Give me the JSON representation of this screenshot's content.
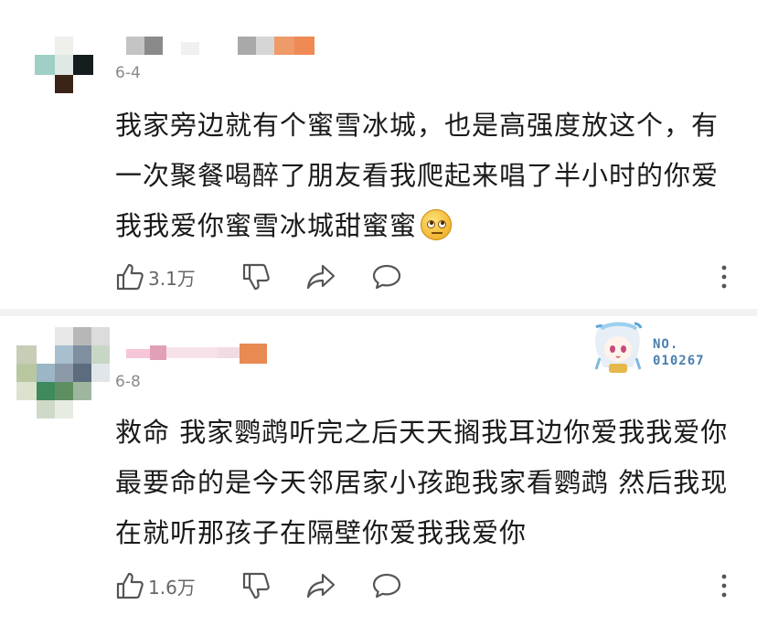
{
  "comments": [
    {
      "date": "6-4",
      "text_lines": [
        "我家旁边就有个蜜雪冰城，也是高强度放这个，有",
        "一次聚餐喝醉了朋友看我爬起来唱了半小时的你爱",
        "我我爱你蜜雪冰城甜蜜蜜"
      ],
      "emoji_icon": "rolling-eyes-emoji",
      "likes": "3.1万"
    },
    {
      "date": "6-8",
      "badge_no_label": "NO.",
      "badge_no_value": "010267",
      "text_lines": [
        "救命 我家鹦鹉听完之后天天搁我耳边你爱我我爱你",
        "最要命的是今天邻居家小孩跑我家看鹦鹉 然后我现",
        "在就听那孩子在隔壁你爱我我爱你"
      ],
      "likes": "1.6万"
    }
  ],
  "icons": {
    "like": "thumbs-up-icon",
    "dislike": "thumbs-down-icon",
    "share": "share-icon",
    "reply": "comment-bubble-icon",
    "more": "more-vertical-icon"
  },
  "colors": {
    "text": "#1a1a1a",
    "meta": "#8a8a8a",
    "icon": "#555555",
    "separator": "#f2f2f2",
    "badge": "#4a7fb0"
  }
}
